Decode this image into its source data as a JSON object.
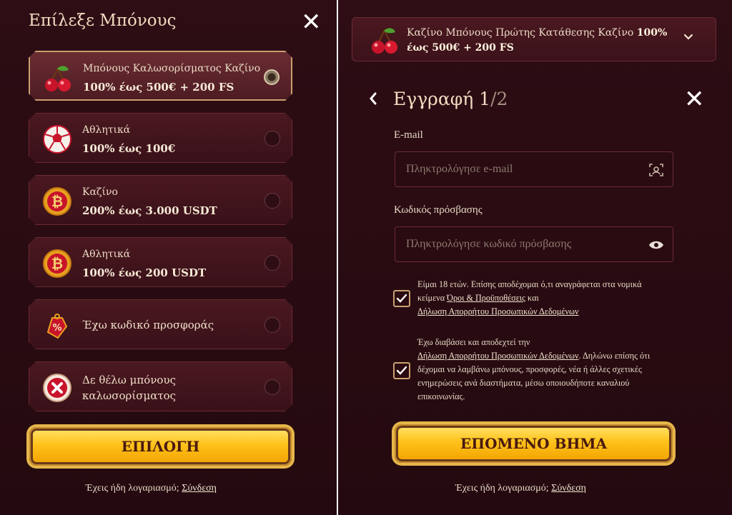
{
  "left": {
    "title": "Επίλεξε Μπόνους",
    "close": "✕",
    "options": [
      {
        "line1": "Μπόνους Καλωσορίσματος Καζίνο",
        "line2": "100% έως 500€ + 200 FS",
        "icon": "cherry-icon",
        "selected": true
      },
      {
        "line1": "Αθλητικά",
        "line2": "100% έως 100€",
        "icon": "soccer-ball-icon",
        "selected": false
      },
      {
        "line1": "Καζίνο",
        "line2": "200% έως 3.000 USDT",
        "icon": "bitcoin-icon",
        "selected": false
      },
      {
        "line1": "Αθλητικά",
        "line2": "100% έως 200 USDT",
        "icon": "bitcoin-icon",
        "selected": false
      },
      {
        "line1": "Έχω κωδικό προσφοράς",
        "icon": "promo-tag-icon",
        "selected": false
      },
      {
        "line1": "Δε θέλω μπόνους",
        "line2": "καλωσορίσματος",
        "icon": "no-bonus-icon",
        "selected": false
      }
    ],
    "select_button": "ΕΠΙΛΟΓΗ",
    "login_prompt": "Έχεις ήδη λογαριασμό;",
    "login_link": "Σύνδεση"
  },
  "right": {
    "selected_bonus": {
      "text": "Καζίνο Μπόνους Πρώτης Κατάθεσης Καζίνο",
      "bold": "100% έως 500€ + 200 FS",
      "icon": "cherry-icon"
    },
    "step_title": "Εγγραφή 1",
    "step_total": "/2",
    "close": "✕",
    "email_label": "E-mail",
    "email_placeholder": "Πληκτρολόγησε e-mail",
    "password_label": "Κωδικός πρόσβασης",
    "password_placeholder": "Πληκτρολόγησε κωδικό πρόσβασης",
    "consent1": {
      "text1": "Είμαι 18 ετών. Επίσης αποδέχομαι ό,τι αναγράφεται στα νομικά κείμενα",
      "link1": "Όροι & Προϋποθέσεις",
      "text2": " και",
      "link2": "Δήλωση Απορρήτου Προσωπικών Δεδομένων"
    },
    "consent2": {
      "text1": "Έχω διαβάσει και αποδεχτεί την",
      "link1": "Δήλωση Απορρήτου Προσωπικών Δεδομένων",
      "text2": ". Δηλώνω επίσης ότι δέχομαι να λαμβάνω μπόνους, προσφορές, νέα ή άλλες σχετικές ενημερώσεις ανά διαστήματα, μέσω οποιουδήποτε καναλιού επικοινωνίας."
    },
    "next_button": "ΕΠΟΜΕΝΟ ΒΗΜΑ",
    "login_prompt": "Έχεις ήδη λογαριασμό;",
    "login_link": "Σύνδεση"
  },
  "colors": {
    "background": "#2a0c12",
    "accent_gold": "#ffc21a",
    "border": "#6b2a33"
  }
}
